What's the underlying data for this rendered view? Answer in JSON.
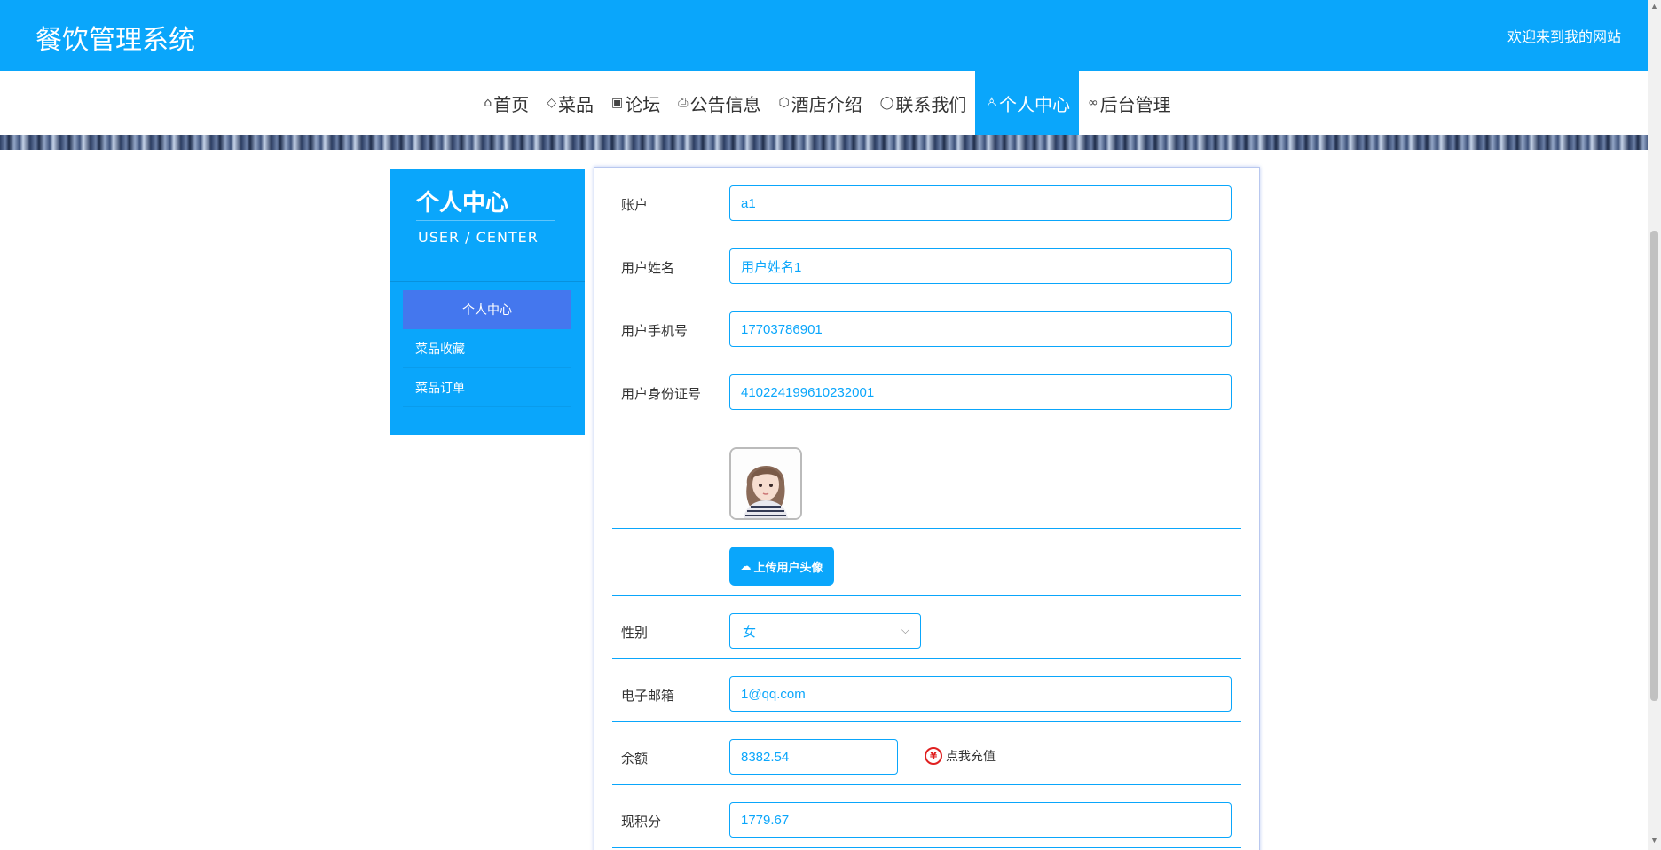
{
  "header": {
    "title": "餐饮管理系统",
    "welcome": "欢迎来到我的网站"
  },
  "nav": {
    "items": [
      {
        "label": "首页",
        "icon": "home-icon",
        "glyph": "⌂"
      },
      {
        "label": "菜品",
        "icon": "tag-icon",
        "glyph": "◇"
      },
      {
        "label": "论坛",
        "icon": "gift-icon",
        "glyph": "▣"
      },
      {
        "label": "公告信息",
        "icon": "printer-icon",
        "glyph": "⎙"
      },
      {
        "label": "酒店介绍",
        "icon": "cube-icon",
        "glyph": "⬡"
      },
      {
        "label": "联系我们",
        "icon": "chat-icon",
        "glyph": "◯"
      },
      {
        "label": "个人中心",
        "icon": "user-icon",
        "glyph": "♙"
      },
      {
        "label": "后台管理",
        "icon": "link-icon",
        "glyph": "∞"
      }
    ],
    "active_index": 6
  },
  "sidebar": {
    "title": "个人中心",
    "subtitle": "USER / CENTER",
    "items": [
      {
        "label": "个人中心"
      },
      {
        "label": "菜品收藏"
      },
      {
        "label": "菜品订单"
      }
    ],
    "active_index": 0
  },
  "form": {
    "account": {
      "label": "账户",
      "value": "a1"
    },
    "name": {
      "label": "用户姓名",
      "value": "用户姓名1"
    },
    "phone": {
      "label": "用户手机号",
      "value": "17703786901"
    },
    "idcard": {
      "label": "用户身份证号",
      "value": "410224199610232001"
    },
    "upload": {
      "label": "上传用户头像"
    },
    "gender": {
      "label": "性别",
      "value": "女"
    },
    "email": {
      "label": "电子邮箱",
      "value": "1@qq.com"
    },
    "balance": {
      "label": "余额",
      "value": "8382.54",
      "recharge_label": "点我充值",
      "recharge_symbol": "¥"
    },
    "points": {
      "label": "现积分",
      "value": "1779.67"
    }
  },
  "colors": {
    "primary": "#0aa6fb",
    "sidebar_active": "#4477ee",
    "recharge_red": "#e02020"
  }
}
